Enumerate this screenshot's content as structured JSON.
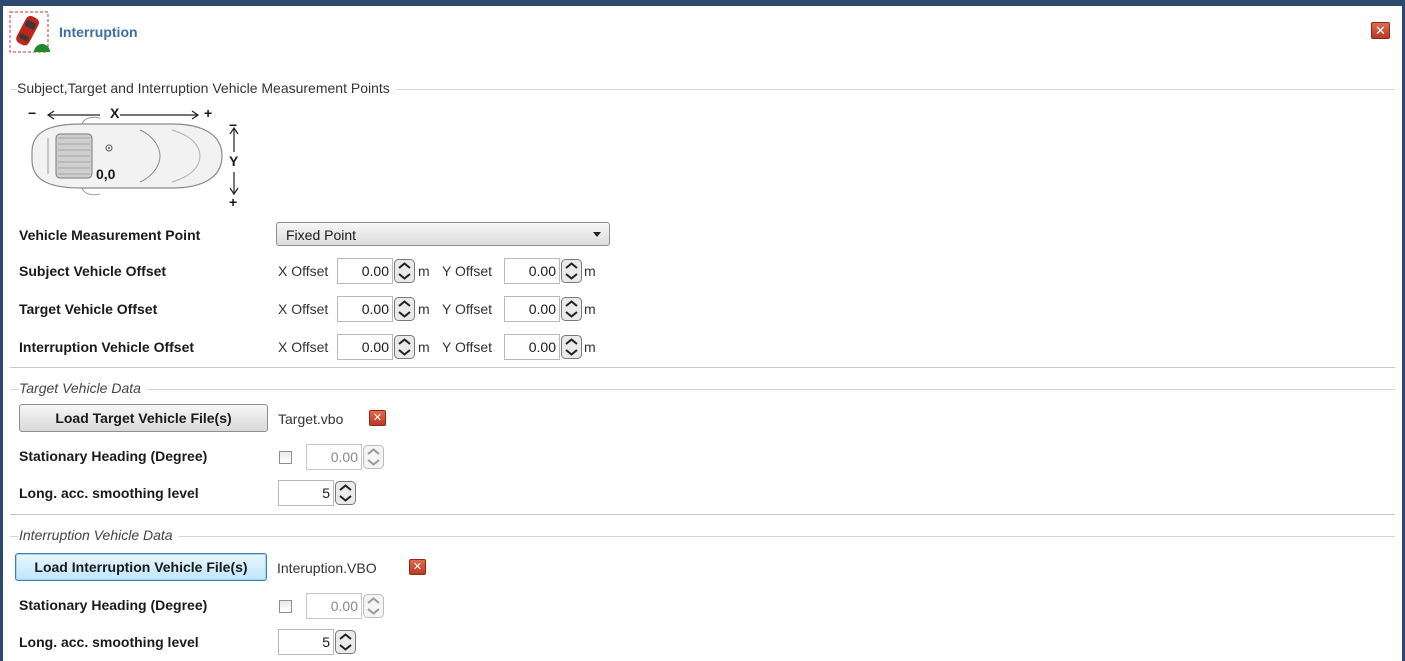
{
  "window": {
    "title": "Interruption",
    "icon": "car-interruption-icon",
    "close_glyph": "✕"
  },
  "measurement": {
    "group_title": "Subject,Target and Interruption Vehicle Measurement Points",
    "diagram": {
      "x_axis_label": "X",
      "y_axis_label": "Y",
      "origin_label": "0,0",
      "minus": "−",
      "plus": "+"
    },
    "point_label": "Vehicle Measurement Point",
    "point_value": "Fixed Point",
    "rows": [
      {
        "label": "Subject Vehicle Offset",
        "x_label": "X Offset",
        "x_value": "0.00",
        "y_label": "Y Offset",
        "y_value": "0.00",
        "unit": "m"
      },
      {
        "label": "Target Vehicle Offset",
        "x_label": "X Offset",
        "x_value": "0.00",
        "y_label": "Y Offset",
        "y_value": "0.00",
        "unit": "m"
      },
      {
        "label": "Interruption Vehicle Offset",
        "x_label": "X Offset",
        "x_value": "0.00",
        "y_label": "Y Offset",
        "y_value": "0.00",
        "unit": "m"
      }
    ]
  },
  "target": {
    "group_title": "Target Vehicle Data",
    "load_button": "Load Target Vehicle File(s)",
    "file_name": "Target.vbo",
    "heading_label": "Stationary Heading (Degree)",
    "heading_checked": false,
    "heading_value": "0.00",
    "smoothing_label": "Long. acc. smoothing level",
    "smoothing_value": "5"
  },
  "interruption": {
    "group_title": "Interruption Vehicle Data",
    "load_button": "Load Interruption Vehicle File(s)",
    "file_name": "Interuption.VBO",
    "heading_label": "Stationary Heading (Degree)",
    "heading_checked": false,
    "heading_value": "0.00",
    "smoothing_label": "Long. acc. smoothing level",
    "smoothing_value": "5"
  },
  "colors": {
    "frame": "#2c4a6e",
    "title": "#3a6fa8",
    "close_red": "#c94a30",
    "focus_blue": "#3c7fb1"
  }
}
